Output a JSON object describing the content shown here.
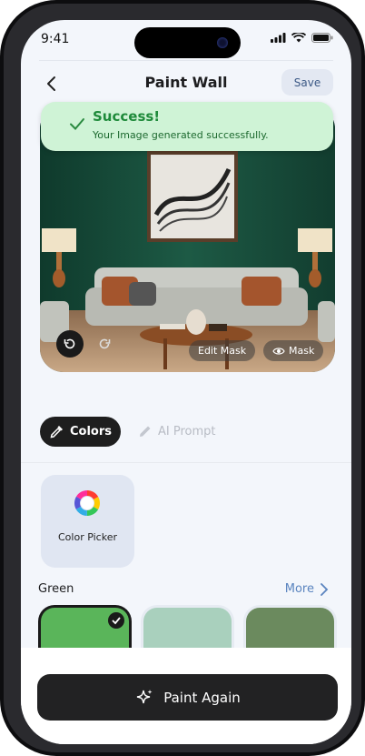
{
  "status_bar": {
    "time": "9:41"
  },
  "header": {
    "title": "Paint Wall",
    "save_label": "Save"
  },
  "toast": {
    "title": "Success!",
    "message": "Your Image generated successfully."
  },
  "image_controls": {
    "edit_mask_label": "Edit Mask",
    "mask_label": "Mask"
  },
  "tabs": [
    {
      "label": "Colors",
      "icon": "dropper-icon",
      "active": true
    },
    {
      "label": "AI Prompt",
      "icon": "pencil-icon",
      "active": false
    }
  ],
  "color_picker": {
    "label": "Color Picker"
  },
  "palette": {
    "name": "Green",
    "more_label": "More",
    "swatches": [
      {
        "color": "#5ab55a",
        "selected": true
      },
      {
        "color": "#a9d0bd",
        "selected": false
      },
      {
        "color": "#6b8a5e",
        "selected": false
      }
    ]
  },
  "cta": {
    "label": "Paint Again"
  },
  "colors": {
    "accent": "#1e1e1e",
    "success": "#1e8a3a",
    "link": "#5a84bf"
  }
}
